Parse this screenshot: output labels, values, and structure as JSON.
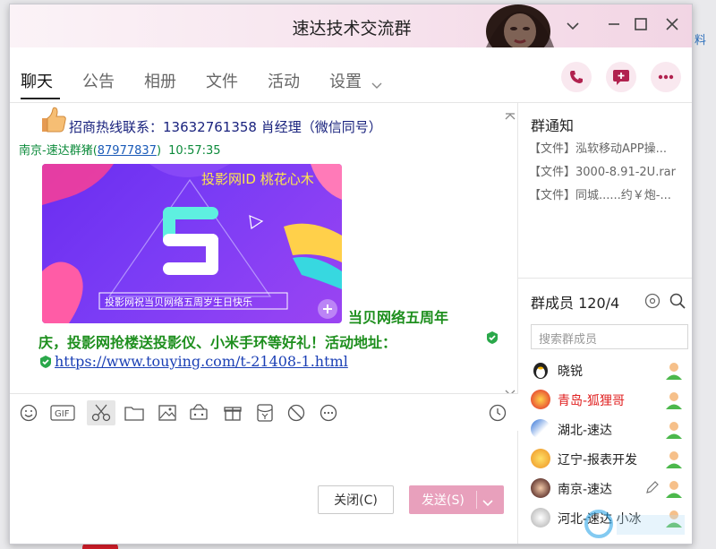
{
  "window": {
    "title": "速达技术交流群"
  },
  "tabs": [
    {
      "label": "聊天"
    },
    {
      "label": "公告"
    },
    {
      "label": "相册"
    },
    {
      "label": "文件"
    },
    {
      "label": "活动"
    },
    {
      "label": "设置"
    }
  ],
  "chat": {
    "msg1_text": "招商热线联系：13632761358 肖经理（微信同号）",
    "sender_name": "南京-速达群猪(",
    "sender_id": "87977837",
    "sender_close": ")",
    "time": "10:57:35",
    "banner_title": "投影网ID 桃花心木",
    "banner_caption": "投影网祝当贝网络五周岁生日快乐",
    "msg2_line1": "当贝网络五周年",
    "msg2_line2": "庆，投影网抢楼送投影仪、小米手环等好礼！活动地址：",
    "link": "https://www.touying.com/t-21408-1.html"
  },
  "buttons": {
    "close": "关闭(C)",
    "send": "发送(S)"
  },
  "right": {
    "notice_title": "群通知",
    "notices": [
      "【文件】泓软移动APP操...",
      "【文件】3000-8.91-2U.rar",
      "【文件】同城......约￥炮-..."
    ],
    "members_title": "群成员 120/4",
    "search_placeholder": "搜索群成员",
    "members": [
      {
        "name": "晓锐",
        "color": "#222222"
      },
      {
        "name": "青岛-狐狸哥",
        "color": "#e02020"
      },
      {
        "name": "湖北-速达",
        "color": "#222222"
      },
      {
        "name": "辽宁-报表开发",
        "color": "#222222"
      },
      {
        "name": "南京-速达",
        "color": "#222222"
      },
      {
        "name": "河北-速达 小冰",
        "color": "#222222"
      }
    ]
  },
  "outside": {
    "right_edge_text": "料"
  }
}
